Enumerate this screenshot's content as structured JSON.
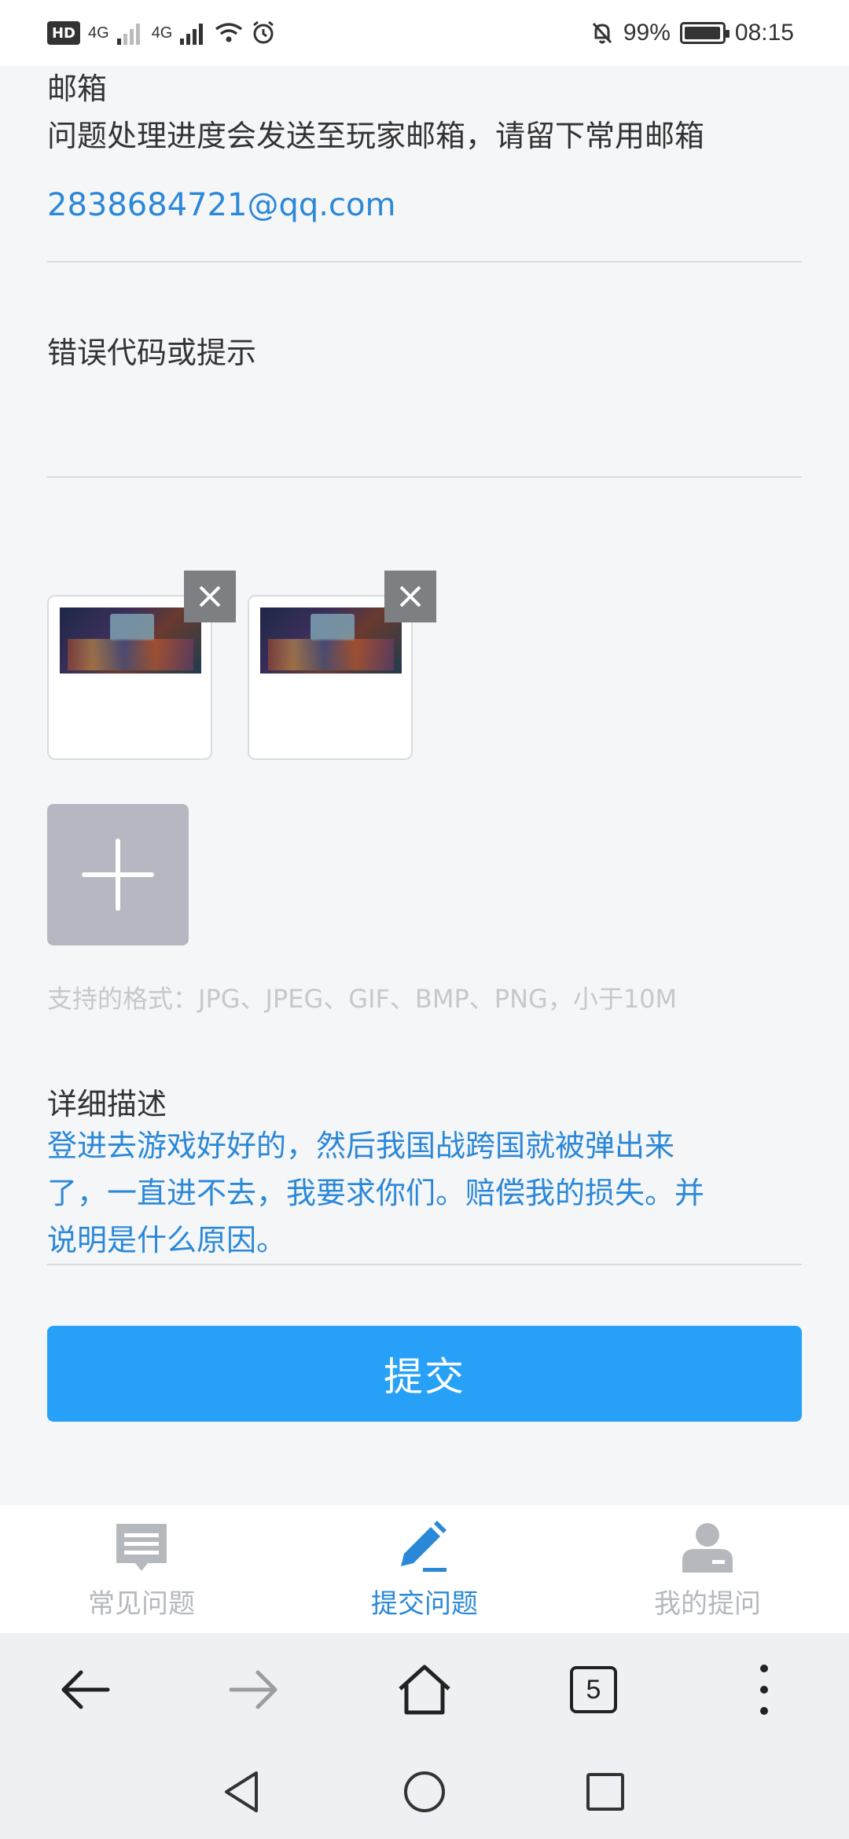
{
  "status_bar": {
    "hd": "HD",
    "net1": "4G",
    "net2": "4G",
    "battery": "99%",
    "time": "08:15",
    "battery_level": 0.99
  },
  "form": {
    "email": {
      "label": "邮箱",
      "hint": "问题处理进度会发送至玩家邮箱，请留下常用邮箱",
      "value": "2838684721@qq.com"
    },
    "error_code": {
      "label": "错误代码或提示",
      "value": ""
    },
    "attachments": {
      "count": 2,
      "formats_hint": "支持的格式：JPG、JPEG、GIF、BMP、PNG，小于10M"
    },
    "description": {
      "label": "详细描述",
      "line1": "登进去游戏好好的，然后我国战跨国就被弹出来",
      "line2": "了，一直进不去，我要求你们。赔偿我的损失。并",
      "line3": "说明是什么原因。"
    },
    "submit_label": "提交"
  },
  "tabs": [
    {
      "label": "常见问题",
      "icon": "faq-list-icon",
      "active": false
    },
    {
      "label": "提交问题",
      "icon": "pencil-icon",
      "active": true
    },
    {
      "label": "我的提问",
      "icon": "user-icon",
      "active": false
    }
  ],
  "browser": {
    "tab_count": "5"
  },
  "colors": {
    "accent": "#2b88d8",
    "button": "#27a1f8",
    "background": "#f5f6f8"
  }
}
